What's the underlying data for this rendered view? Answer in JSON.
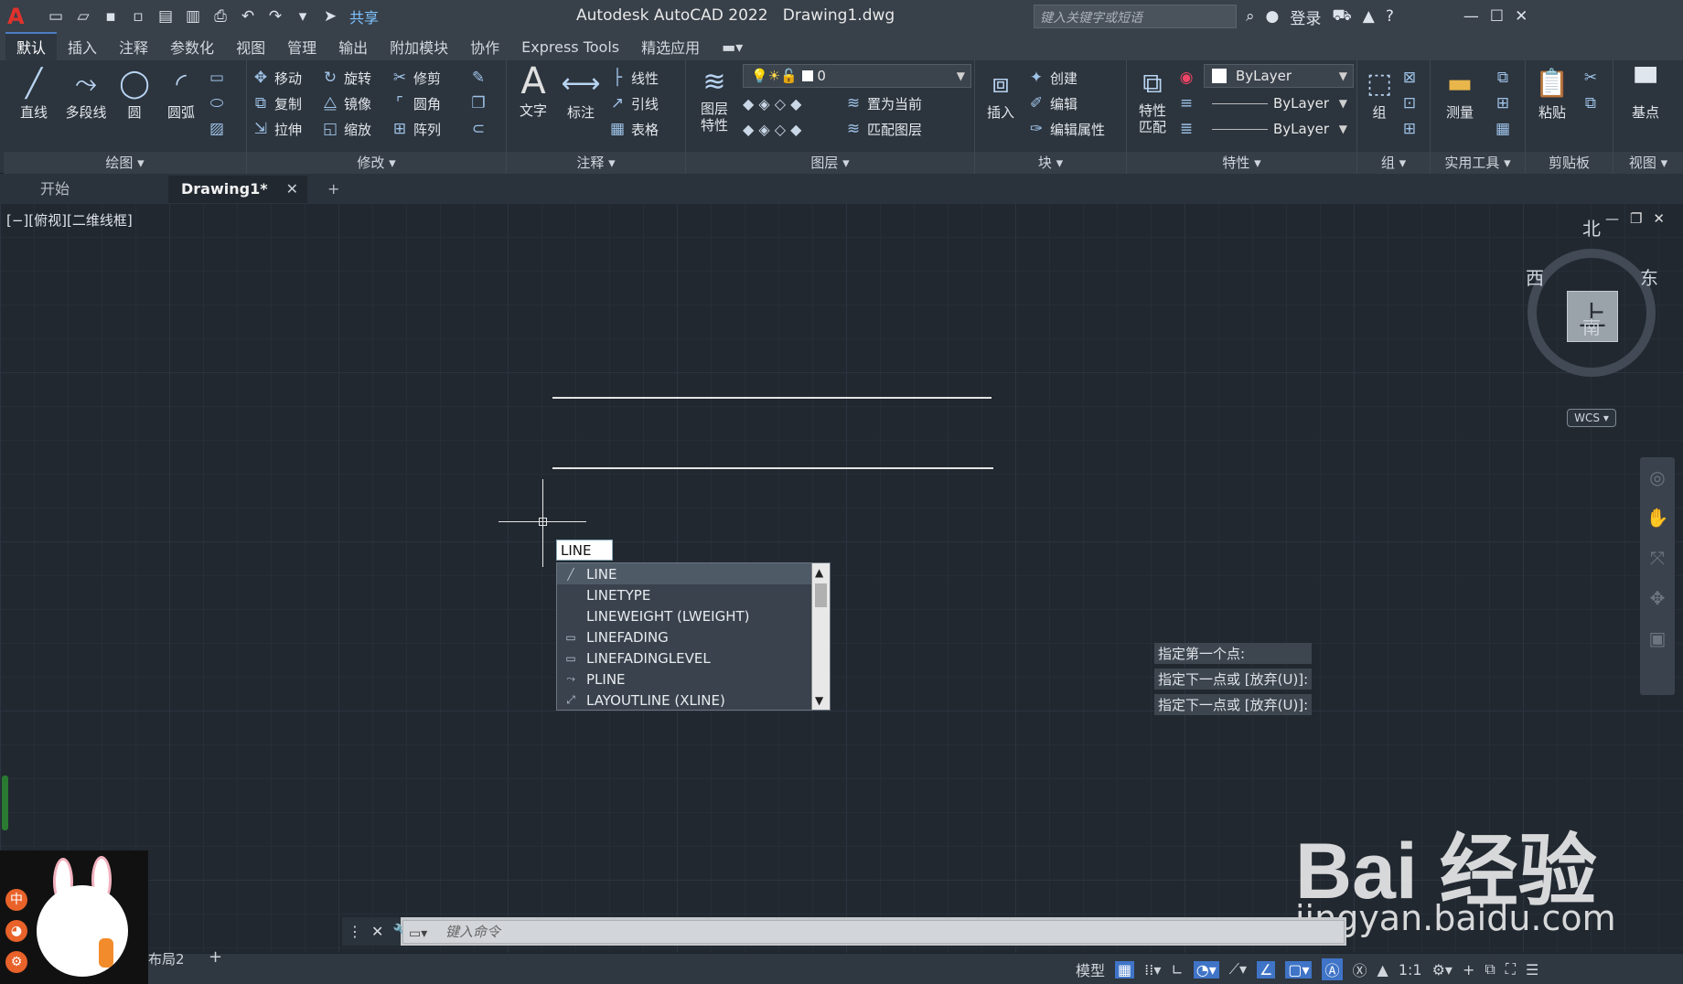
{
  "app": {
    "logo": "A",
    "title": "Autodesk AutoCAD 2022",
    "doc": "Drawing1.dwg",
    "share": "共享"
  },
  "search": {
    "placeholder": "键入关键字或短语"
  },
  "signin": "登录",
  "menu_tabs": [
    "默认",
    "插入",
    "注释",
    "参数化",
    "视图",
    "管理",
    "输出",
    "附加模块",
    "协作",
    "Express Tools",
    "精选应用"
  ],
  "panels": {
    "draw": {
      "title": "绘图",
      "line": "直线",
      "pline": "多段线",
      "circle": "圆",
      "arc": "圆弧"
    },
    "modify": {
      "title": "修改",
      "move": "移动",
      "rotate": "旋转",
      "trim": "修剪",
      "copy": "复制",
      "mirror": "镜像",
      "fillet": "圆角",
      "stretch": "拉伸",
      "scale": "缩放",
      "array": "阵列"
    },
    "annot": {
      "title": "注释",
      "text": "文字",
      "dim": "标注",
      "linear": "线性",
      "leader": "引线",
      "table": "表格"
    },
    "layers": {
      "title": "图层",
      "props": "图层特性",
      "current_layer": "0",
      "set_current": "置为当前",
      "match": "匹配图层"
    },
    "block": {
      "title": "块",
      "insert": "插入",
      "create": "创建",
      "edit": "编辑",
      "edit_attr": "编辑属性"
    },
    "props": {
      "title": "特性",
      "match": "特性匹配",
      "color": "ByLayer",
      "linetype": "ByLayer",
      "lineweight": "ByLayer"
    },
    "group": {
      "title": "组",
      "label": "组"
    },
    "utilities": {
      "title": "实用工具",
      "measure": "测量"
    },
    "clipboard": {
      "title": "剪贴板",
      "paste": "粘贴"
    },
    "view": {
      "title": "视图",
      "base": "基点"
    }
  },
  "doc_tabs": {
    "start": "开始",
    "drawing": "Drawing1*"
  },
  "viewport_label": "[−][俯视][二维线框]",
  "viewcube": {
    "top": "上",
    "north": "北",
    "south": "南",
    "east": "东",
    "west": "西",
    "wcs": "WCS"
  },
  "dynamic_input": "LINE",
  "autocomplete": [
    {
      "label": "LINE",
      "icon": "line-icon"
    },
    {
      "label": "LINETYPE",
      "icon": ""
    },
    {
      "label": "LINEWEIGHT (LWEIGHT)",
      "icon": ""
    },
    {
      "label": "LINEFADING",
      "icon": "sysvar-icon"
    },
    {
      "label": "LINEFADINGLEVEL",
      "icon": "sysvar-icon"
    },
    {
      "label": "PLINE",
      "icon": "pline-icon"
    },
    {
      "label": "LAYOUTLINE (XLINE)",
      "icon": "xline-icon"
    }
  ],
  "history": [
    "指定第一个点:",
    "指定下一点或 [放弃(U)]:",
    "指定下一点或 [放弃(U)]:"
  ],
  "command": {
    "placeholder": "键入命令"
  },
  "layout2": "布局2",
  "status": {
    "model": "模型",
    "scale": "1:1"
  },
  "watermark": {
    "main": "Bai 经验",
    "sub": "jingyan.baidu.com"
  },
  "bunny_icons": [
    "中",
    "◕",
    "⚙"
  ]
}
